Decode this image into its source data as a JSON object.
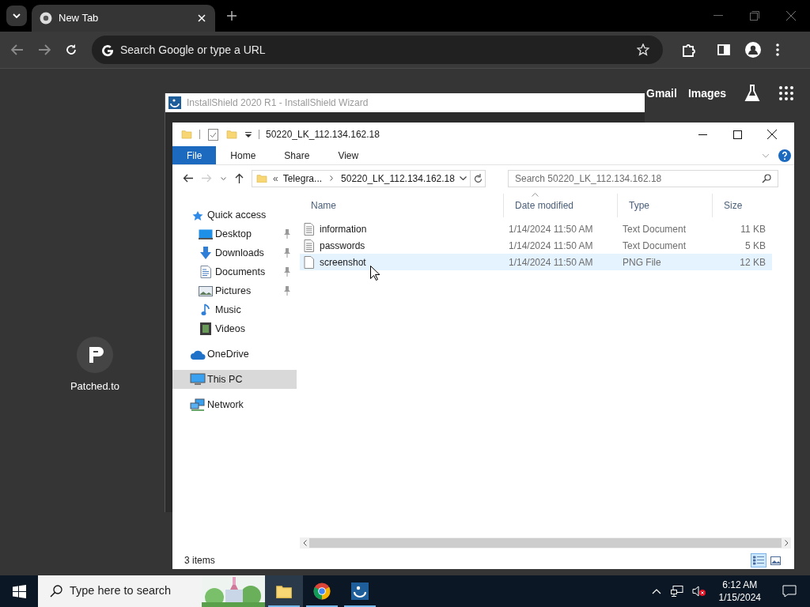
{
  "browser": {
    "tabs": [
      {
        "label": "New Tab",
        "selected": true
      }
    ],
    "omnibox": {
      "placeholder": "Search Google or type a URL"
    },
    "links": [
      "Gmail",
      "Images"
    ]
  },
  "desktop_icons": [
    {
      "label": "Patched.to"
    }
  ],
  "installer_window": {
    "title": "InstallShield 2020 R1 - InstallShield Wizard"
  },
  "explorer": {
    "title": "50220_LK_112.134.162.18",
    "ribbon_tabs": [
      {
        "label": "File",
        "selected": true
      },
      {
        "label": "Home",
        "selected": false
      },
      {
        "label": "Share",
        "selected": false
      },
      {
        "label": "View",
        "selected": false
      }
    ],
    "address": {
      "overflow": "«",
      "parts": [
        "Telegra...",
        "50220_LK_112.134.162.18"
      ]
    },
    "search": {
      "placeholder": "Search 50220_LK_112.134.162.18"
    },
    "nav": [
      {
        "label": "Quick access",
        "selected": false,
        "children": [
          {
            "label": "Desktop",
            "pinned": true,
            "selected": false
          },
          {
            "label": "Downloads",
            "pinned": true,
            "selected": false
          },
          {
            "label": "Documents",
            "pinned": true,
            "selected": false
          },
          {
            "label": "Pictures",
            "pinned": true,
            "selected": false
          },
          {
            "label": "Music",
            "pinned": false,
            "selected": false
          },
          {
            "label": "Videos",
            "pinned": false,
            "selected": false
          }
        ]
      },
      {
        "label": "OneDrive",
        "selected": false
      },
      {
        "label": "This PC",
        "selected": true
      },
      {
        "label": "Network",
        "selected": false
      }
    ],
    "columns": [
      "Name",
      "Date modified",
      "Type",
      "Size"
    ],
    "rows": [
      {
        "kind": "text",
        "name": "information",
        "date": "1/14/2024 11:50 AM",
        "type": "Text Document",
        "size": "11 KB",
        "selected": false
      },
      {
        "kind": "text",
        "name": "passwords",
        "date": "1/14/2024 11:50 AM",
        "type": "Text Document",
        "size": "5 KB",
        "selected": false
      },
      {
        "kind": "blank",
        "name": "screenshot",
        "date": "1/14/2024 11:50 AM",
        "type": "PNG File",
        "size": "12 KB",
        "selected": true
      }
    ],
    "status": "3 items"
  },
  "taskbar": {
    "search": {
      "placeholder": "Type here to search"
    },
    "apps": [
      {
        "selected": true,
        "running": true
      },
      {
        "selected": false,
        "running": true
      },
      {
        "selected": false,
        "running": true
      }
    ],
    "time": "6:12 AM",
    "date": "1/15/2024"
  }
}
